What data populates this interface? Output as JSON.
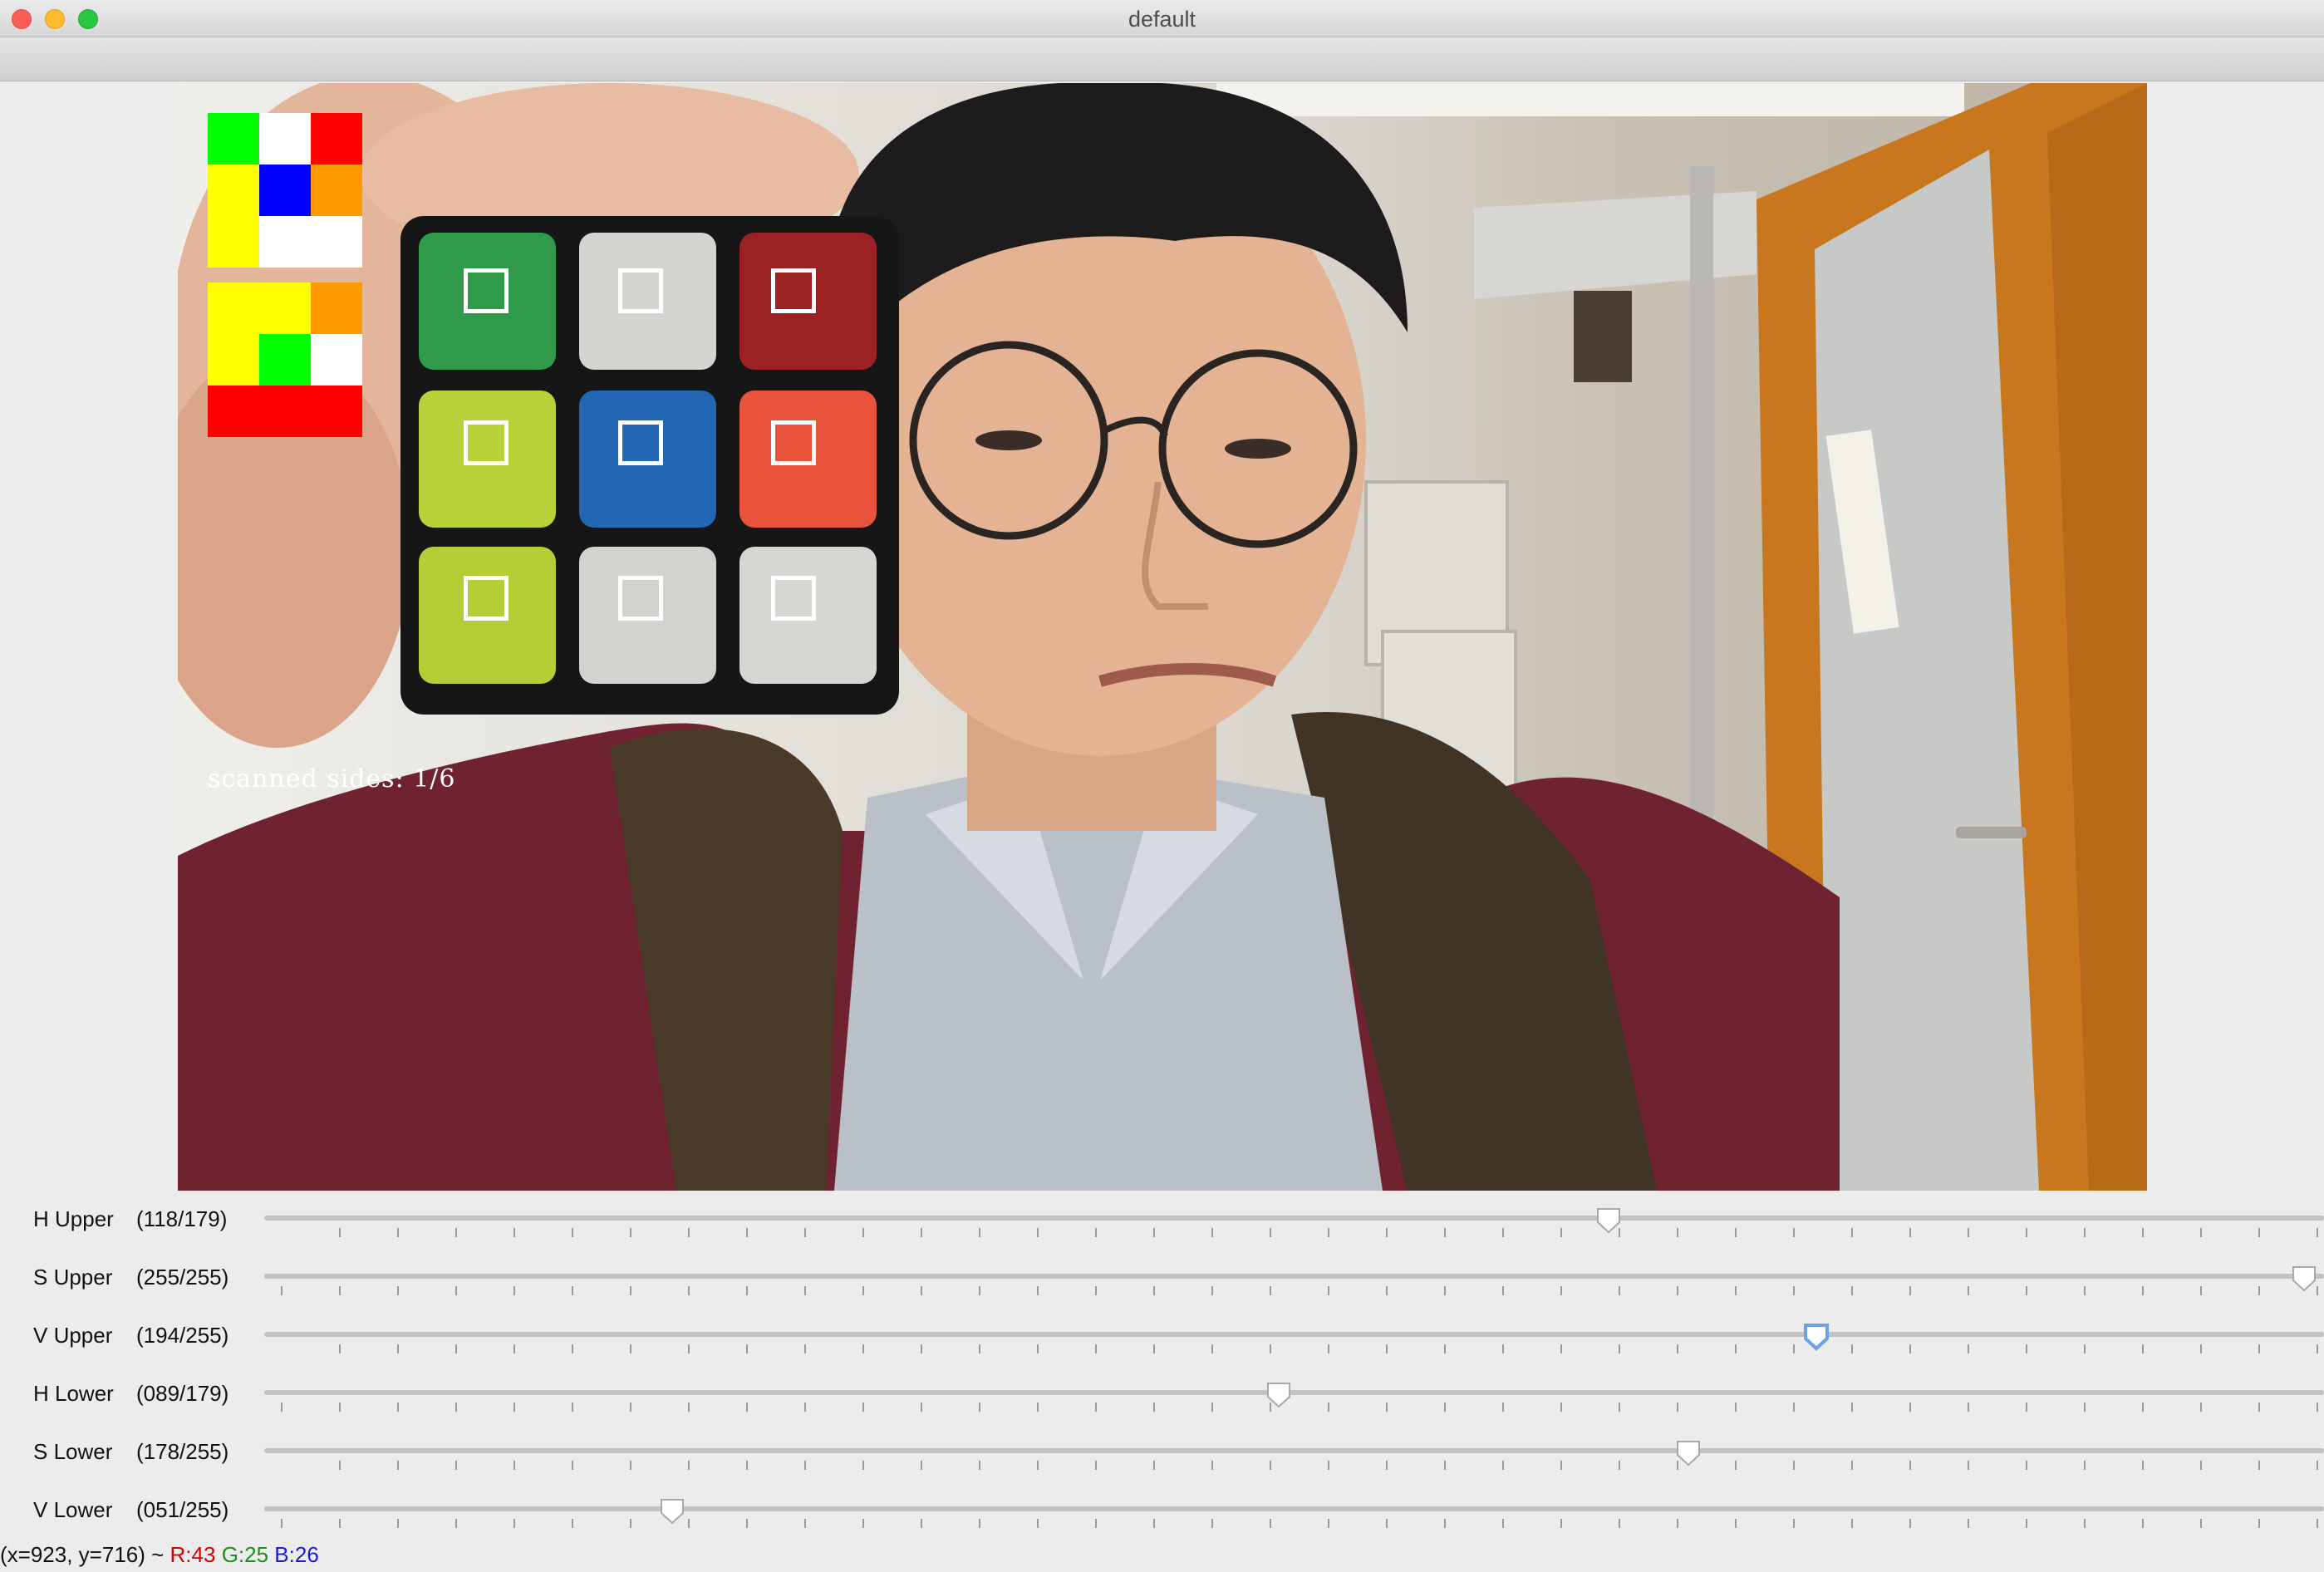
{
  "window": {
    "title": "default"
  },
  "video": {
    "overlay_text": "scanned sides: 1/6",
    "preview_faces": [
      [
        "#00ff00",
        "#ffffff",
        "#ff0000",
        "#ffff00",
        "#0000ff",
        "#ff9900",
        "#ffff00",
        "#ffffff",
        "#ffffff"
      ],
      [
        "#ffff00",
        "#ffff00",
        "#ff9900",
        "#ffff00",
        "#00ff00",
        "#ffffff",
        "#ff0000",
        "#ff0000",
        "#ff0000"
      ]
    ],
    "cube_stickers": [
      "#2f9a49",
      "#d4d4d0",
      "#9c2122",
      "#b8d33a",
      "#2366b3",
      "#e9533b",
      "#b4cf36",
      "#d2d2cf",
      "#d6d6d3"
    ]
  },
  "trackbars": [
    {
      "label": "H Upper",
      "value_text": "(118/179)",
      "value": 118,
      "max": 179,
      "focused": false
    },
    {
      "label": "S Upper",
      "value_text": "(255/255)",
      "value": 255,
      "max": 255,
      "focused": false
    },
    {
      "label": "V Upper",
      "value_text": "(194/255)",
      "value": 194,
      "max": 255,
      "focused": true
    },
    {
      "label": "H Lower",
      "value_text": "(089/179)",
      "value": 89,
      "max": 179,
      "focused": false
    },
    {
      "label": "S Lower",
      "value_text": "(178/255)",
      "value": 178,
      "max": 255,
      "focused": false
    },
    {
      "label": "V Lower",
      "value_text": "(051/255)",
      "value": 51,
      "max": 255,
      "focused": false
    }
  ],
  "status": {
    "coords": "(x=923, y=716) ~ ",
    "r": "R:43",
    "g": "G:25",
    "b": "B:26"
  }
}
